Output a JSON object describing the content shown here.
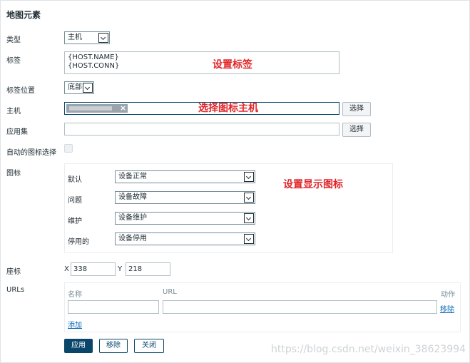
{
  "form": {
    "title": "地图元素",
    "type": {
      "label": "类型",
      "value": "主机"
    },
    "tag": {
      "label": "标签",
      "line1": "{HOST.NAME}",
      "line2": "{HOST.CONN}"
    },
    "tag_position": {
      "label": "标签位置",
      "value": "底部"
    },
    "host": {
      "label": "主机",
      "chip_close": "×",
      "select_button": "选择"
    },
    "app_set": {
      "label": "应用集",
      "value": "",
      "select_button": "选择"
    },
    "auto_icon": {
      "label": "自动的图标选择"
    },
    "icons": {
      "label": "图标",
      "rows": [
        {
          "label": "默认",
          "value": "设备正常"
        },
        {
          "label": "问题",
          "value": "设备故障"
        },
        {
          "label": "维护",
          "value": "设备维护"
        },
        {
          "label": "停用的",
          "value": "设备停用"
        }
      ]
    },
    "coords": {
      "label": "座标",
      "x_label": "X",
      "x_value": "338",
      "y_label": "Y",
      "y_value": "218"
    },
    "urls": {
      "label": "URLs",
      "col_name": "名称",
      "col_url": "URL",
      "col_action": "动作",
      "row": {
        "name": "",
        "url": "",
        "remove": "移除"
      },
      "add": "添加"
    },
    "buttons": {
      "apply": "应用",
      "remove": "移除",
      "close": "关闭"
    }
  },
  "annotations": {
    "set_label": "设置标签",
    "select_host": "选择图标主机",
    "set_icon": "设置显示图标"
  },
  "watermark": "https://blog.csdn.net/weixin_38623994",
  "colors": {
    "accent": "#0a466a",
    "annotation": "#e0262a",
    "link": "#0a6bb5"
  }
}
